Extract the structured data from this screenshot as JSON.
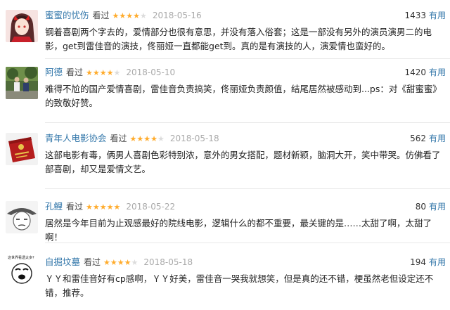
{
  "reviews": [
    {
      "author": "蜜蜜的忧伤",
      "seen": "看过",
      "rating": 4,
      "stars_on": "★★★★",
      "stars_off": "★",
      "date": "2018-05-16",
      "votes": "1433",
      "useful": "有用",
      "content": "钢着喜剧两个字去的，爱情部分也很有意思，并没有落入俗套；这是一部没有另外的演员演男二的电影，get到雷佳音的演技，佟丽娅一直都能get到。真的是有演技的人，演爱情也蛮好的。",
      "avatar_icon": "anime-girl-avatar-icon"
    },
    {
      "author": "阿德",
      "seen": "看过",
      "rating": 4,
      "stars_on": "★★★★",
      "stars_off": "★",
      "date": "2018-05-10",
      "votes": "1420",
      "useful": "有用",
      "content": "难得不尬的国产爱情喜剧，雷佳音负责搞笑，佟丽娅负责颜值，结尾居然被感动到...ps：对《甜蜜蜜》的致敬好赞。",
      "avatar_icon": "street-photo-avatar-icon"
    },
    {
      "author": "青年人电影协会",
      "seen": "看过",
      "rating": 4,
      "stars_on": "★★★★",
      "stars_off": "★",
      "date": "2018-05-18",
      "votes": "562",
      "useful": "有用",
      "content": "这部电影有毒，俩男人喜剧色彩特别浓，意外的男女搭配，题材新颖，脑洞大开，笑中带哭。仿佛看了部喜剧，却又是爱情文艺。",
      "avatar_icon": "red-book-avatar-icon"
    },
    {
      "author": "孔鲤",
      "seen": "看过",
      "rating": 5,
      "stars_on": "★★★★★",
      "stars_off": "",
      "date": "2018-05-22",
      "votes": "80",
      "useful": "有用",
      "content": "居然是今年目前为止观感最好的院线电影，逻辑什么的都不重要，最关键的是……太甜了啊，太甜了啊！",
      "avatar_icon": "sketch-face-avatar-icon"
    },
    {
      "author": "自掘坟墓",
      "seen": "看过",
      "rating": 4,
      "stars_on": "★★★★",
      "stars_off": "★",
      "date": "2018-05-18",
      "votes": "194",
      "useful": "有用",
      "content": "ＹＹ和雷佳音好有cp感啊，ＹＹ好美，雷佳音一哭我就想笑，但是真的还不错，梗虽然老但设定还不错，推荐。",
      "avatar_caption": "这世界看透太多？",
      "avatar_icon": "meme-face-avatar-icon"
    }
  ]
}
